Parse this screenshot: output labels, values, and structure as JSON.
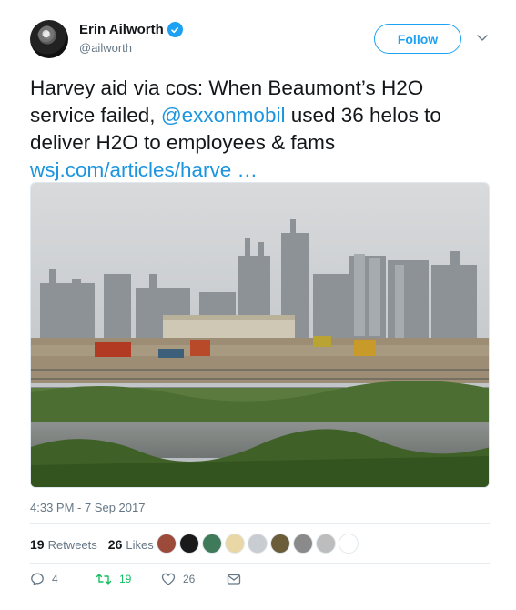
{
  "author": {
    "display_name": "Erin Ailworth",
    "handle": "@ailworth",
    "verified": true
  },
  "follow_label": "Follow",
  "tweet": {
    "text_start": "Harvey aid via cos: When Beaumont’s H2O service failed, ",
    "mention": "@exxonmobil",
    "text_end": " used 36 helos to deliver H2O to employees & fams ",
    "link": "wsj.com/articles/harve …"
  },
  "timestamp": "4:33 PM - 7 Sep 2017",
  "stats": {
    "retweets_count": "19",
    "retweets_label": "Retweets",
    "likes_count": "26",
    "likes_label": "Likes"
  },
  "likers": [
    {
      "icon": "liker-avatar",
      "color": "#9c4a3a"
    },
    {
      "icon": "liker-avatar",
      "color": "#1a1a1a"
    },
    {
      "icon": "liker-avatar",
      "color": "#3f7a5a"
    },
    {
      "icon": "liker-avatar",
      "color": "#e9d8a6"
    },
    {
      "icon": "liker-avatar",
      "color": "#c9ccd1"
    },
    {
      "icon": "liker-avatar",
      "color": "#6b5d3a"
    },
    {
      "icon": "liker-avatar",
      "color": "#8a8a8a"
    },
    {
      "icon": "liker-avatar",
      "color": "#bdbdbd"
    },
    {
      "icon": "liker-avatar",
      "color": "#ffffff"
    }
  ],
  "actions": {
    "reply_count": "4",
    "retweet_count": "19",
    "like_count": "26"
  },
  "colors": {
    "accent": "#1da1f2",
    "link": "#1b95e0",
    "retweet_green": "#17bf63",
    "muted": "#657786"
  }
}
